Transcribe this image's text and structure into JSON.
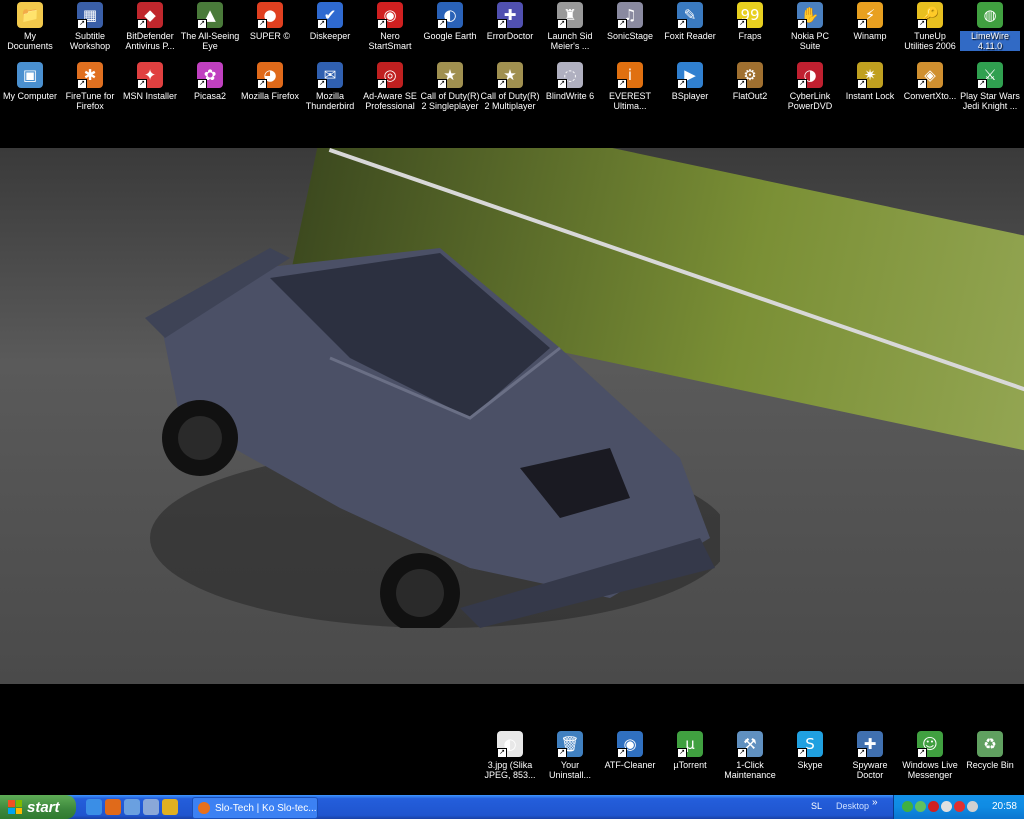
{
  "desktop_icons_top_row1": [
    {
      "label": "My Documents",
      "icon": "my-documents-icon",
      "color": "#f2c94c",
      "glyph": "📁",
      "selected": false,
      "shortcut": false
    },
    {
      "label": "Subtitle Workshop",
      "icon": "subtitle-workshop-icon",
      "color": "#3a5fa8",
      "glyph": "▦",
      "selected": false,
      "shortcut": true
    },
    {
      "label": "BitDefender Antivirus P...",
      "icon": "bitdefender-icon",
      "color": "#c0272d",
      "glyph": "◆",
      "selected": false,
      "shortcut": true
    },
    {
      "label": "The All-Seeing Eye",
      "icon": "all-seeing-eye-icon",
      "color": "#4a7a3a",
      "glyph": "▲",
      "selected": false,
      "shortcut": true
    },
    {
      "label": "SUPER ©",
      "icon": "super-icon",
      "color": "#e04020",
      "glyph": "●",
      "selected": false,
      "shortcut": true
    },
    {
      "label": "Diskeeper",
      "icon": "diskeeper-icon",
      "color": "#2f6ad0",
      "glyph": "✔",
      "selected": false,
      "shortcut": true
    },
    {
      "label": "Nero StartSmart",
      "icon": "nero-icon",
      "color": "#d02020",
      "glyph": "◉",
      "selected": false,
      "shortcut": true
    },
    {
      "label": "Google Earth",
      "icon": "google-earth-icon",
      "color": "#2a62b8",
      "glyph": "◐",
      "selected": false,
      "shortcut": true
    },
    {
      "label": "ErrorDoctor",
      "icon": "errordoctor-icon",
      "color": "#5050b0",
      "glyph": "✚",
      "selected": false,
      "shortcut": true
    },
    {
      "label": "Launch Sid Meier's ...",
      "icon": "civilization-icon",
      "color": "#999999",
      "glyph": "♜",
      "selected": false,
      "shortcut": true
    },
    {
      "label": "SonicStage",
      "icon": "sonicstage-icon",
      "color": "#8a8aa0",
      "glyph": "♫",
      "selected": false,
      "shortcut": true
    },
    {
      "label": "Foxit Reader",
      "icon": "foxit-reader-icon",
      "color": "#3a7ac0",
      "glyph": "✎",
      "selected": false,
      "shortcut": true
    },
    {
      "label": "Fraps",
      "icon": "fraps-icon",
      "color": "#e8d020",
      "glyph": "99",
      "selected": false,
      "shortcut": true
    },
    {
      "label": "Nokia PC Suite",
      "icon": "nokia-pc-suite-icon",
      "color": "#4a80c0",
      "glyph": "✋",
      "selected": false,
      "shortcut": true
    },
    {
      "label": "Winamp",
      "icon": "winamp-icon",
      "color": "#e8a020",
      "glyph": "⚡",
      "selected": false,
      "shortcut": true
    },
    {
      "label": "TuneUp Utilities 2006",
      "icon": "tuneup-icon",
      "color": "#e8c020",
      "glyph": "🔑",
      "selected": false,
      "shortcut": true
    },
    {
      "label": "LimeWire 4.11.0",
      "icon": "limewire-icon",
      "color": "#40a040",
      "glyph": "◍",
      "selected": true,
      "shortcut": false
    }
  ],
  "desktop_icons_top_row2": [
    {
      "label": "My Computer",
      "icon": "my-computer-icon",
      "color": "#4a90d0",
      "glyph": "▣",
      "selected": false,
      "shortcut": false
    },
    {
      "label": "FireTune for Firefox",
      "icon": "firetune-icon",
      "color": "#e07020",
      "glyph": "✱",
      "selected": false,
      "shortcut": true
    },
    {
      "label": "MSN Installer",
      "icon": "msn-installer-icon",
      "color": "#e04040",
      "glyph": "✦",
      "selected": false,
      "shortcut": true
    },
    {
      "label": "Picasa2",
      "icon": "picasa-icon",
      "color": "#c040c0",
      "glyph": "✿",
      "selected": false,
      "shortcut": true
    },
    {
      "label": "Mozilla Firefox",
      "icon": "firefox-icon",
      "color": "#e06a1a",
      "glyph": "◕",
      "selected": false,
      "shortcut": true
    },
    {
      "label": "Mozilla Thunderbird",
      "icon": "thunderbird-icon",
      "color": "#3060b0",
      "glyph": "✉",
      "selected": false,
      "shortcut": true
    },
    {
      "label": "Ad-Aware SE Professional",
      "icon": "ad-aware-icon",
      "color": "#c02020",
      "glyph": "◎",
      "selected": false,
      "shortcut": true
    },
    {
      "label": "Call of Duty(R) 2 Singleplayer",
      "icon": "call-of-duty-sp-icon",
      "color": "#a09050",
      "glyph": "★",
      "selected": false,
      "shortcut": true
    },
    {
      "label": "Call of Duty(R) 2 Multiplayer",
      "icon": "call-of-duty-mp-icon",
      "color": "#a09050",
      "glyph": "★",
      "selected": false,
      "shortcut": true
    },
    {
      "label": "BlindWrite 6",
      "icon": "blindwrite-icon",
      "color": "#b0b0c0",
      "glyph": "◌",
      "selected": false,
      "shortcut": true
    },
    {
      "label": "EVEREST Ultima...",
      "icon": "everest-icon",
      "color": "#e07010",
      "glyph": "i",
      "selected": false,
      "shortcut": true
    },
    {
      "label": "BSplayer",
      "icon": "bsplayer-icon",
      "color": "#3080d0",
      "glyph": "▶",
      "selected": false,
      "shortcut": true
    },
    {
      "label": "FlatOut2",
      "icon": "flatout2-icon",
      "color": "#a07030",
      "glyph": "⚙",
      "selected": false,
      "shortcut": true
    },
    {
      "label": "CyberLink PowerDVD",
      "icon": "powerdvd-icon",
      "color": "#c02030",
      "glyph": "◑",
      "selected": false,
      "shortcut": true
    },
    {
      "label": "Instant Lock",
      "icon": "instant-lock-icon",
      "color": "#c0a020",
      "glyph": "✷",
      "selected": false,
      "shortcut": true
    },
    {
      "label": "ConvertXto...",
      "icon": "convertxtodvd-icon",
      "color": "#d09030",
      "glyph": "◈",
      "selected": false,
      "shortcut": true
    },
    {
      "label": "Play Star Wars Jedi Knight ...",
      "icon": "star-wars-icon",
      "color": "#30a050",
      "glyph": "⚔",
      "selected": false,
      "shortcut": true
    }
  ],
  "desktop_icons_bottom": [
    {
      "label": "3.jpg (Slika JPEG, 853...",
      "icon": "jpg-file-icon",
      "color": "#e8e8e8",
      "glyph": "◐",
      "selected": false,
      "shortcut": true
    },
    {
      "label": "Your Uninstall...",
      "icon": "your-uninstaller-icon",
      "color": "#4080c0",
      "glyph": "🗑",
      "selected": false,
      "shortcut": true
    },
    {
      "label": "ATF-Cleaner",
      "icon": "atf-cleaner-icon",
      "color": "#3070c0",
      "glyph": "◉",
      "selected": false,
      "shortcut": true
    },
    {
      "label": "µTorrent",
      "icon": "utorrent-icon",
      "color": "#40a040",
      "glyph": "µ",
      "selected": false,
      "shortcut": true
    },
    {
      "label": "1-Click Maintenance",
      "icon": "one-click-maintenance-icon",
      "color": "#6090c0",
      "glyph": "⚒",
      "selected": false,
      "shortcut": true
    },
    {
      "label": "Skype",
      "icon": "skype-icon",
      "color": "#20a0e0",
      "glyph": "S",
      "selected": false,
      "shortcut": true
    },
    {
      "label": "Spyware Doctor",
      "icon": "spyware-doctor-icon",
      "color": "#4070b0",
      "glyph": "✚",
      "selected": false,
      "shortcut": true
    },
    {
      "label": "Windows Live Messenger",
      "icon": "windows-live-messenger-icon",
      "color": "#40a040",
      "glyph": "☺",
      "selected": false,
      "shortcut": true
    },
    {
      "label": "Recycle Bin",
      "icon": "recycle-bin-icon",
      "color": "#60a060",
      "glyph": "♻",
      "selected": false,
      "shortcut": false
    }
  ],
  "taskbar": {
    "start_label": "start",
    "quick_launch": [
      {
        "icon": "ie-icon",
        "color": "#3a8ee6"
      },
      {
        "icon": "firefox-quicklaunch-icon",
        "color": "#e06a1a"
      },
      {
        "icon": "show-desktop-icon",
        "color": "#6aa0e0"
      },
      {
        "icon": "media-player-icon",
        "color": "#8aa8d8"
      },
      {
        "icon": "winamp-quicklaunch-icon",
        "color": "#e0b020"
      }
    ],
    "active_task": "Slo-Tech | Ko Slo-tec...",
    "language": "SL",
    "desktop_toolbar": "Desktop",
    "chevron": "»",
    "tray_icons": [
      {
        "icon": "utorrent-tray-icon",
        "color": "#40b040"
      },
      {
        "icon": "messenger-tray-icon",
        "color": "#60c060"
      },
      {
        "icon": "nero-tray-icon",
        "color": "#d02020"
      },
      {
        "icon": "network-tray-icon",
        "color": "#e0e0e0"
      },
      {
        "icon": "antivirus-tray-icon",
        "color": "#e03030"
      },
      {
        "icon": "volume-tray-icon",
        "color": "#d0d0d0"
      }
    ],
    "clock": "20:58"
  }
}
